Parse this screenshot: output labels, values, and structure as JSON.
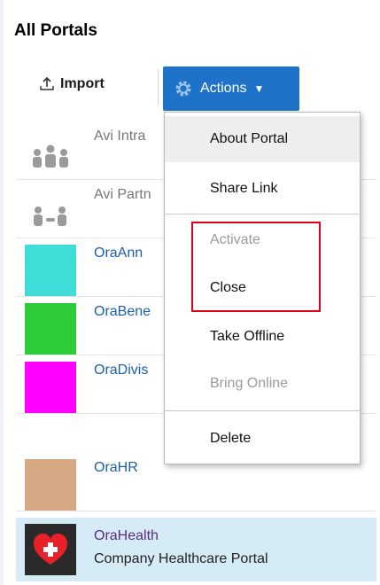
{
  "header": {
    "title": "All Portals"
  },
  "toolbar": {
    "import_label": "Import",
    "actions_label": "Actions"
  },
  "portals": [
    {
      "name": "Avi Intra",
      "icon": "people-group-icon"
    },
    {
      "name": "Avi Partn",
      "icon": "people-partner-icon"
    },
    {
      "name": "OraAnn",
      "color": "#40dcd8"
    },
    {
      "name": "OraBene",
      "color": "#2fcc3a"
    },
    {
      "name": "OraDivis",
      "color": "#ff00ff"
    },
    {
      "name": "OraHR",
      "color": "#d6a883"
    },
    {
      "name": "OraHealth",
      "description": "Company Healthcare Portal",
      "icon": "heart-icon"
    }
  ],
  "actions_menu": {
    "items": [
      {
        "label": "About Portal",
        "enabled": true
      },
      {
        "label": "Share Link",
        "enabled": true
      },
      {
        "label": "Activate",
        "enabled": false
      },
      {
        "label": "Close",
        "enabled": true
      },
      {
        "label": "Take Offline",
        "enabled": true
      },
      {
        "label": "Bring Online",
        "enabled": false
      },
      {
        "label": "Delete",
        "enabled": true
      }
    ]
  },
  "colors": {
    "accent": "#1e73c8",
    "selected_row": "#d5ecf7",
    "highlight": "#e0001a"
  }
}
